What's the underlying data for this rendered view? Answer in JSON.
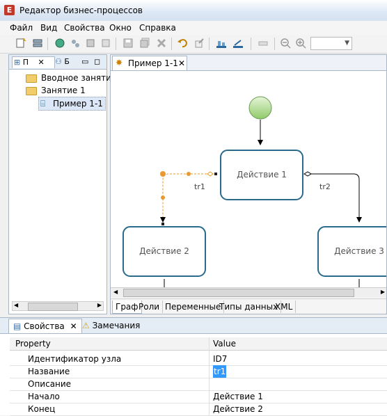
{
  "window": {
    "title": "Редактор бизнес-процессов",
    "icon_letter": "E"
  },
  "menu": [
    "Файл",
    "Вид",
    "Свойства",
    "Окно",
    "Справка"
  ],
  "left_panel": {
    "tabs": [
      {
        "label": "П"
      },
      {
        "label": "Б"
      }
    ],
    "tree": [
      {
        "label": "Вводное занятие",
        "type": "folder"
      },
      {
        "label": "Занятие 1",
        "type": "folder"
      },
      {
        "label": "Пример 1-1",
        "type": "process",
        "selected": true
      }
    ]
  },
  "editor": {
    "tab_label": "Пример 1-1",
    "diagram": {
      "nodes": [
        {
          "label": "Действие 1"
        },
        {
          "label": "Действие 2"
        },
        {
          "label": "Действие 3"
        }
      ],
      "transitions": [
        {
          "label": "tr1"
        },
        {
          "label": "tr2"
        }
      ]
    },
    "bottom_tabs": [
      "Граф",
      "Роли",
      "Переменные",
      "Типы данных",
      "XML"
    ]
  },
  "properties": {
    "tabs": [
      {
        "label": "Свойства"
      },
      {
        "label": "Замечания"
      }
    ],
    "columns": {
      "property": "Property",
      "value": "Value"
    },
    "rows": [
      {
        "key": "Идентификатор узла",
        "value": "ID7"
      },
      {
        "key": "Название",
        "value": "tr1"
      },
      {
        "key": "Описание",
        "value": ""
      },
      {
        "key": "Начало",
        "value": "Действие 1"
      },
      {
        "key": "Конец",
        "value": "Действие 2"
      }
    ]
  },
  "colors": {
    "node_border": "#2a6a8a",
    "selection": "#f0a030",
    "accent": "#3399ff"
  }
}
